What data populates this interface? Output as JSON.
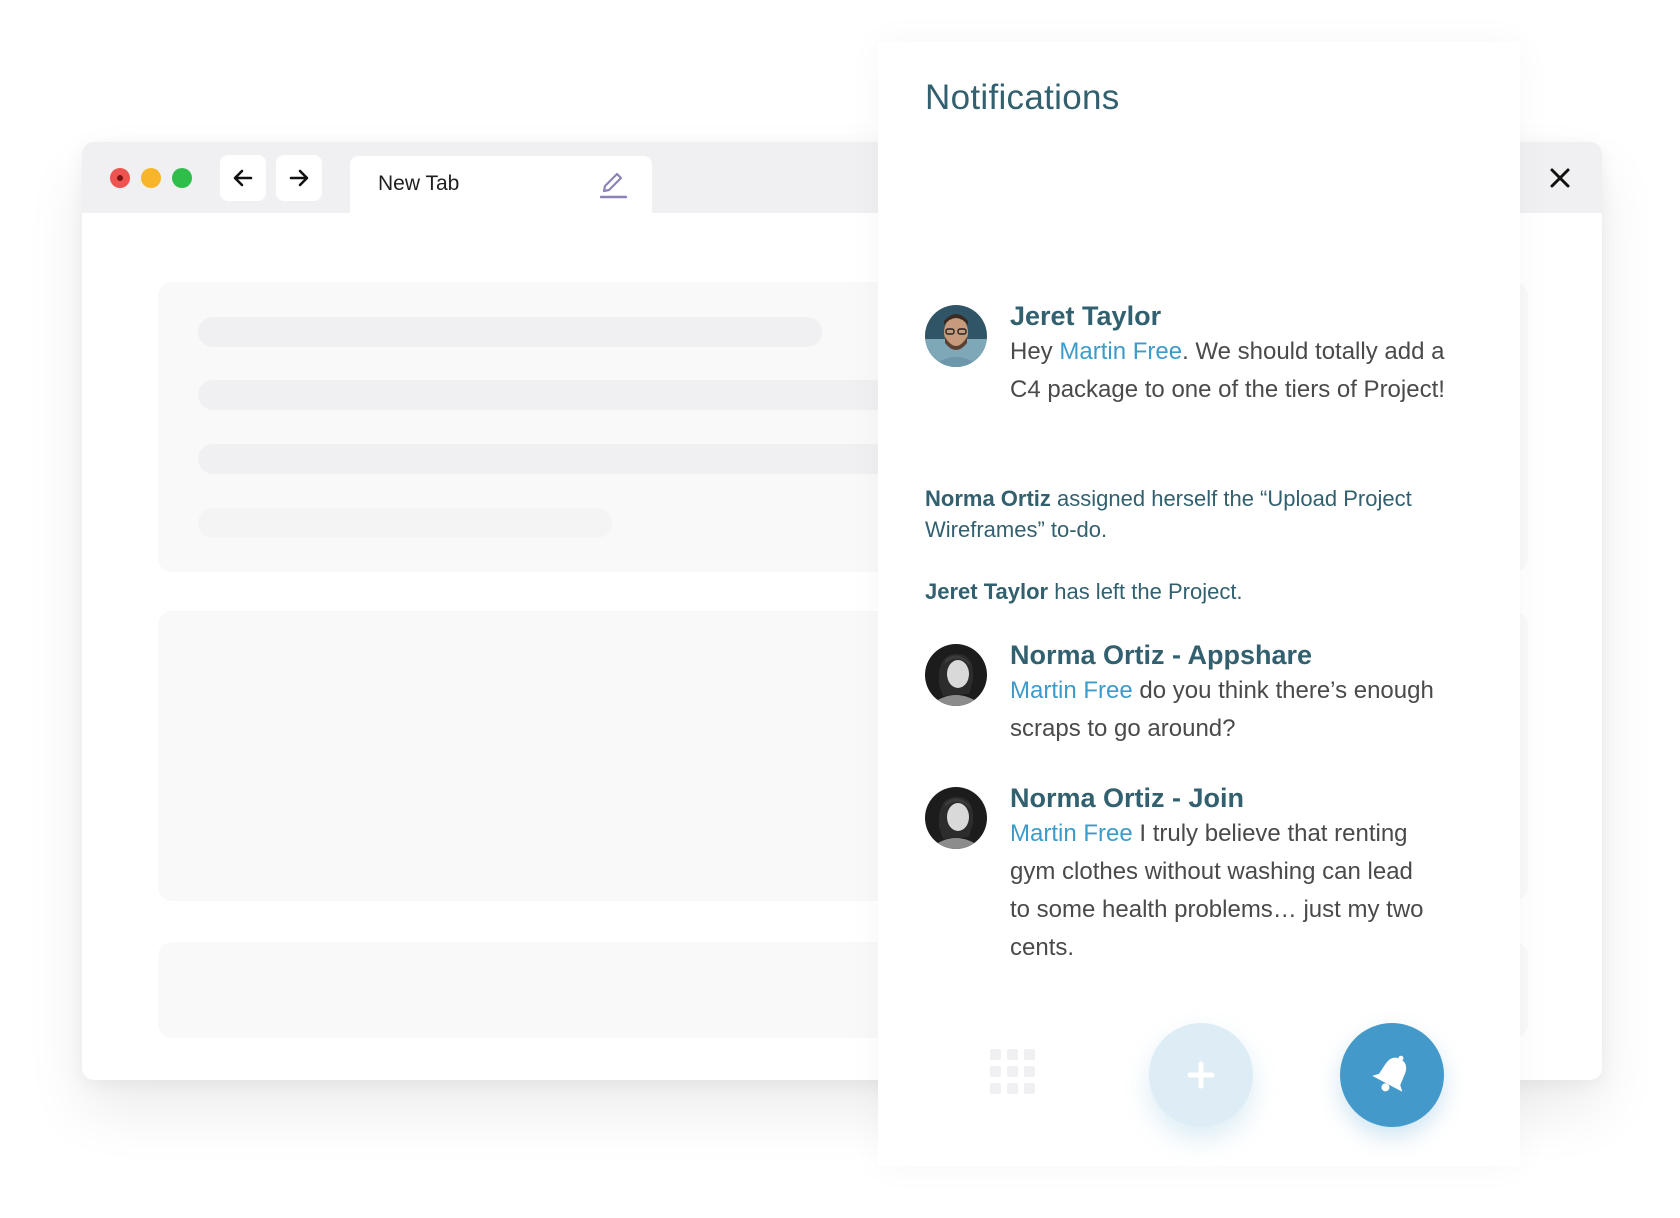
{
  "browser": {
    "tab_title": "New Tab",
    "close_icon": "close-icon",
    "back_icon": "arrow-left-icon",
    "forward_icon": "arrow-right-icon",
    "edit_icon": "pencil-icon"
  },
  "notifications": {
    "title": "Notifications",
    "items": [
      {
        "type": "message",
        "author": "Jeret Taylor",
        "prefix": "Hey ",
        "mention": "Martin Free",
        "text_line1": ". We should totally add a",
        "text_line2": "C4 package to one of the tiers of Project!"
      },
      {
        "type": "activity",
        "actor": "Norma Ortiz",
        "text_line1": " assigned herself the “Upload Project",
        "text_line2": "Wireframes” to-do."
      },
      {
        "type": "activity",
        "actor": "Jeret Taylor",
        "text_line1": " has left the Project."
      },
      {
        "type": "message",
        "author": "Norma Ortiz - Appshare",
        "mention": "Martin Free",
        "text_line1": " do you think there’s enough",
        "text_line2": "scraps to go around?"
      },
      {
        "type": "message",
        "author": "Norma Ortiz - Join",
        "mention": "Martin Free",
        "text_line1": " I truly believe that renting",
        "text_line2": "gym clothes without washing can lead",
        "text_line3": "to some health problems… just my two",
        "text_line4": "cents."
      }
    ]
  },
  "actions": {
    "apps_icon": "grid-icon",
    "add_icon": "plus-icon",
    "bell_icon": "bell-icon"
  },
  "colors": {
    "heading": "#32606f",
    "mention": "#3d9bc9",
    "bell_button": "#4499cb",
    "add_button": "#deedf5"
  }
}
